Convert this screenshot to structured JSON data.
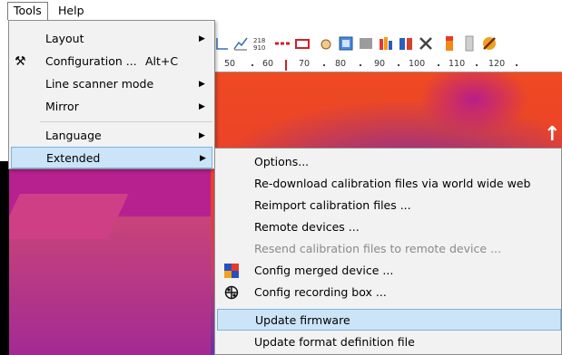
{
  "menubar": {
    "tools": "Tools",
    "help": "Help"
  },
  "ruler": {
    "labels": [
      "50",
      "60",
      "70",
      "80",
      "90",
      "100",
      "110",
      "120"
    ]
  },
  "tools_menu": {
    "items": [
      {
        "label": "Layout",
        "has_submenu": true
      },
      {
        "label": "Configuration ...",
        "shortcut": "Alt+C",
        "icon": "tools-icon"
      },
      {
        "label": "Line scanner mode",
        "has_submenu": true
      },
      {
        "label": "Mirror",
        "has_submenu": true
      },
      {
        "label": "Language",
        "has_submenu": true
      },
      {
        "label": "Extended",
        "has_submenu": true,
        "highlighted": true
      }
    ]
  },
  "extended_menu": {
    "items": [
      {
        "label": "Options..."
      },
      {
        "label": "Re-download calibration files via world wide web"
      },
      {
        "label": "Reimport calibration files ..."
      },
      {
        "label": "Remote devices ..."
      },
      {
        "label": "Resend calibration files to remote device ...",
        "disabled": true
      },
      {
        "label": "Config merged device ...",
        "icon": "merged-device-icon"
      },
      {
        "label": "Config recording box ...",
        "icon": "recording-box-icon"
      },
      {
        "label": "Update firmware",
        "highlighted": true
      },
      {
        "label": "Update format definition file"
      }
    ]
  },
  "colors": {
    "highlight": "#cce4f7",
    "highlight_border": "#7ab4e0",
    "menu_bg": "#f2f2f2"
  }
}
